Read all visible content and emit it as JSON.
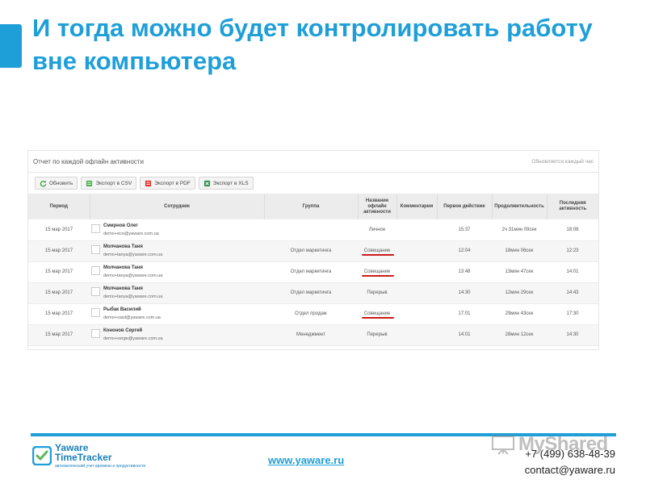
{
  "slide": {
    "title": "И тогда можно будет контролировать работу вне компьютера"
  },
  "report": {
    "title": "Отчет по каждой офлайн активности",
    "update_note": "Обновляется каждый час",
    "toolbar": {
      "refresh": "Обновить",
      "export_csv": "Экспорт в CSV",
      "export_pdf": "Экспорт в PDF",
      "export_xls": "Экспорт в XLS"
    },
    "columns": {
      "period": "Период",
      "employee": "Сотрудник",
      "group": "Группа",
      "activity": "Название офлайн активности",
      "comments": "Комментарии",
      "first_action": "Первое действие",
      "duration": "Продолжительность",
      "last_activity": "Последняя активность"
    },
    "rows": [
      {
        "period": "15 мар 2017",
        "name": "Смирнов Олег",
        "email": "demo+eco@yaware.com.ua",
        "group": "",
        "activity": "Личное",
        "comments": "",
        "first": "15:37",
        "duration": "2ч 31мин 09сек",
        "last": "18:08"
      },
      {
        "period": "15 мар 2017",
        "name": "Молчанова Таня",
        "email": "demo+tanya@yaware.com.ua",
        "group": "Отдел маркетинга",
        "activity": "Совещание",
        "comments": "",
        "first": "12:04",
        "duration": "18мин 06сек",
        "last": "12:23"
      },
      {
        "period": "15 мар 2017",
        "name": "Молчанова Таня",
        "email": "demo+tanya@yaware.com.ua",
        "group": "Отдел маркетинга",
        "activity": "Совещание",
        "comments": "",
        "first": "13:48",
        "duration": "13мин 47сек",
        "last": "14:01"
      },
      {
        "period": "15 мар 2017",
        "name": "Молчанова Таня",
        "email": "demo+tanya@yaware.com.ua",
        "group": "Отдел маркетинга",
        "activity": "Перерыв",
        "comments": "",
        "first": "14:30",
        "duration": "12мин 29сек",
        "last": "14:43"
      },
      {
        "period": "15 мар 2017",
        "name": "Рыбак Василий",
        "email": "demo+vasil@yaware.com.ua",
        "group": "Отдел продаж",
        "activity": "Совещание",
        "comments": "",
        "first": "17:01",
        "duration": "29мин 43сек",
        "last": "17:30"
      },
      {
        "period": "15 мар 2017",
        "name": "Кононов Сергей",
        "email": "demo+serge@yaware.com.ua",
        "group": "Менеджмент",
        "activity": "Перерыв",
        "comments": "",
        "first": "14:01",
        "duration": "28мин 12сек",
        "last": "14:30"
      }
    ],
    "highlight_color": "#cc1a1a"
  },
  "footer": {
    "logo_line1": "Yaware",
    "logo_line2": "TimeTracker",
    "logo_tagline": "автоматический учет времени и продуктивности",
    "website": "www.yaware.ru",
    "phone": "+7 (499) 638-48-39",
    "email": "contact@yaware.ru",
    "watermark": "MyShared"
  },
  "colors": {
    "accent": "#1e9fd8",
    "underline": "#cc1a1a"
  }
}
